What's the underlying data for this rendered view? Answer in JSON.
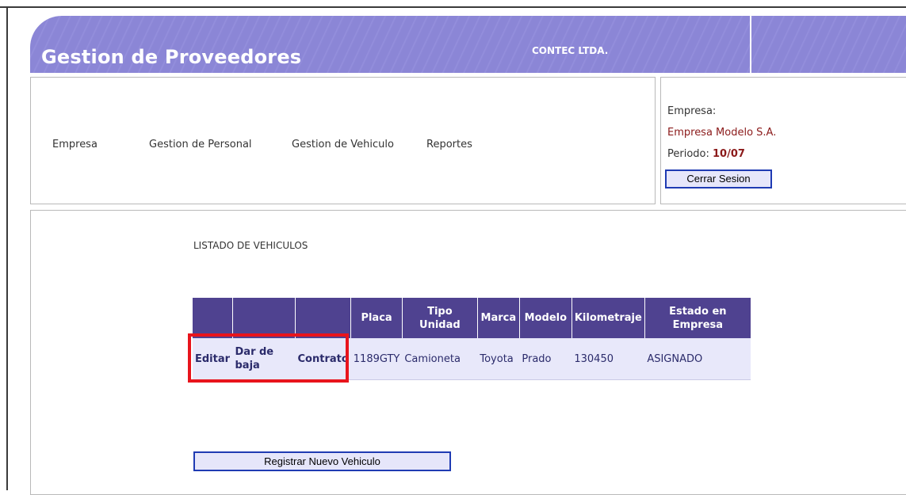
{
  "header": {
    "title": "Gestion de Proveedores",
    "company": "CONTEC LTDA."
  },
  "nav": {
    "items": [
      {
        "label": "Empresa"
      },
      {
        "label": "Gestion de Personal"
      },
      {
        "label": "Gestion de Vehiculo"
      },
      {
        "label": "Reportes"
      }
    ]
  },
  "session": {
    "empresa_label": "Empresa:",
    "empresa_value": "Empresa Modelo S.A.",
    "periodo_label": "Periodo:",
    "periodo_value": "10/07",
    "logout_label": "Cerrar Sesion"
  },
  "vehicles": {
    "title": "LISTADO DE VEHICULOS",
    "columns": [
      "",
      "",
      "",
      "Placa",
      "Tipo Unidad",
      "Marca",
      "Modelo",
      "Kilometraje",
      "Estado en Empresa"
    ],
    "rows": [
      {
        "edit": "Editar",
        "remove": "Dar de baja",
        "contract": "Contrato",
        "placa": "1189GTY",
        "tipo": "Camioneta",
        "marca": "Toyota",
        "modelo": "Prado",
        "kilometraje": "130450",
        "estado": "ASIGNADO"
      }
    ],
    "register_label": "Registrar Nuevo Vehiculo"
  },
  "colors": {
    "header_bg": "#8b86d6",
    "table_header_bg": "#4f4290",
    "row_bg": "#e8e8fa",
    "value_red": "#8b1a1a",
    "highlight": "#e8141c",
    "button_border": "#1f3bb3"
  }
}
